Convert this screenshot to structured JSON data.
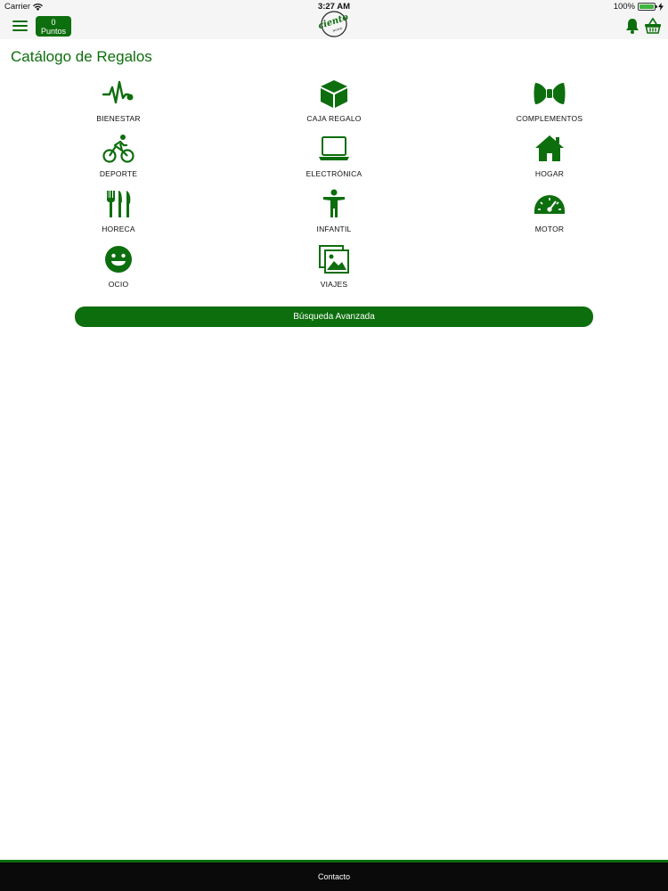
{
  "status_bar": {
    "carrier": "Carrier",
    "time": "3:27 AM",
    "battery": "100%"
  },
  "navbar": {
    "points_value": "0",
    "points_label": "Puntos",
    "logo_text": "ciento",
    "logo_subtext": "terreno"
  },
  "page": {
    "title": "Catálogo de Regalos"
  },
  "categories": [
    {
      "label": "BIENESTAR",
      "icon": "heartbeat-icon"
    },
    {
      "label": "CAJA REGALO",
      "icon": "gift-box-icon"
    },
    {
      "label": "COMPLEMENTOS",
      "icon": "bow-tie-icon"
    },
    {
      "label": "DEPORTE",
      "icon": "bicycle-icon"
    },
    {
      "label": "ELECTRÓNICA",
      "icon": "laptop-icon"
    },
    {
      "label": "HOGAR",
      "icon": "house-icon"
    },
    {
      "label": "HORECA",
      "icon": "cutlery-icon"
    },
    {
      "label": "INFANTIL",
      "icon": "child-icon"
    },
    {
      "label": "MOTOR",
      "icon": "speedometer-icon"
    },
    {
      "label": "OCIO",
      "icon": "smiley-icon"
    },
    {
      "label": "VIAJES",
      "icon": "photos-icon"
    }
  ],
  "search_button": {
    "label": "Búsqueda Avanzada"
  },
  "footer": {
    "label": "Contacto"
  },
  "colors": {
    "brand": "#0d6e0d",
    "footer_bg": "#0a0a0a",
    "statusbar_bg": "#f5f5f5"
  }
}
